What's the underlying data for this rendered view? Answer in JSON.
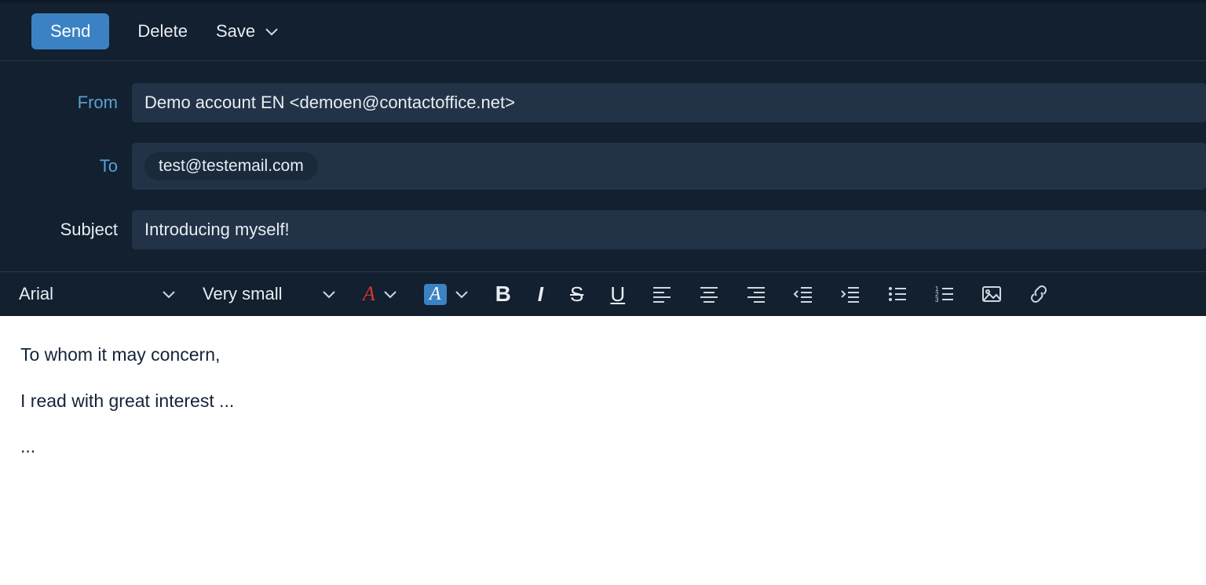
{
  "toolbar": {
    "send": "Send",
    "delete": "Delete",
    "save": "Save"
  },
  "headers": {
    "from_label": "From",
    "from_value": "Demo account EN <demoen@contactoffice.net>",
    "to_label": "To",
    "to_chip": "test@testemail.com",
    "subject_label": "Subject",
    "subject_value": "Introducing myself!"
  },
  "format": {
    "font": "Arial",
    "size": "Very small",
    "font_color_glyph": "A",
    "highlight_glyph": "A",
    "bold": "B",
    "italic": "I",
    "strike": "S",
    "underline": "U"
  },
  "body": {
    "line1": "To whom it may concern,",
    "line2": "I read with great interest ...",
    "line3": "..."
  }
}
